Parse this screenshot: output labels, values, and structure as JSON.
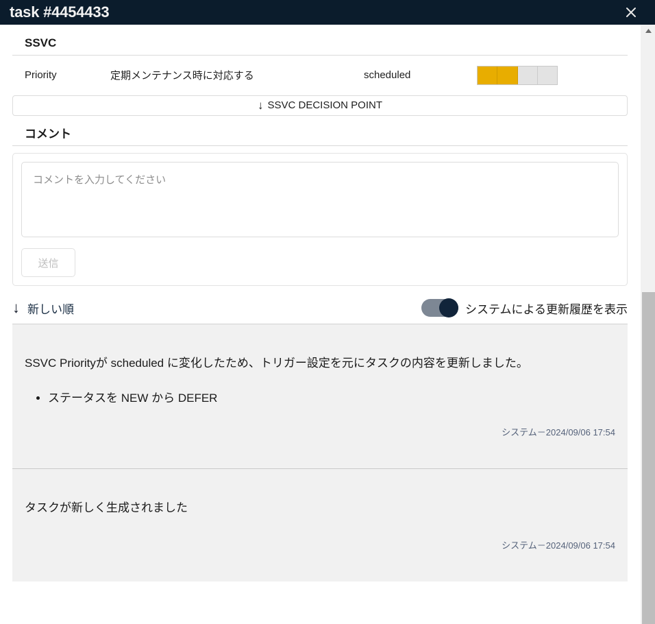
{
  "window": {
    "title": "task #4454433",
    "close_icon": "close-icon"
  },
  "ssvc": {
    "section_title": "SSVC",
    "priority_label": "Priority",
    "priority_description": "定期メンテナンス時に対応する",
    "priority_value": "scheduled",
    "meter": {
      "total_segments": 4,
      "filled_segments": 2,
      "filled_color": "#e8ad00",
      "empty_color": "#e3e3e3"
    },
    "decision_point_button": {
      "arrow": "↓",
      "label": "SSVC DECISION POINT"
    }
  },
  "comments": {
    "section_title": "コメント",
    "input_placeholder": "コメントを入力してください",
    "input_value": "",
    "submit_label": "送信",
    "submit_disabled": true
  },
  "list_controls": {
    "sort": {
      "arrow": "↓",
      "label": "新しい順"
    },
    "toggle": {
      "label": "システムによる更新履歴を表示",
      "state": "on",
      "knob_color": "#11243a",
      "track_color": "#7d8794"
    }
  },
  "history": [
    {
      "text": "SSVC Priorityが scheduled に変化したため、トリガー設定を元にタスクの内容を更新しました。",
      "bullets": [
        "ステータスを NEW から DEFER"
      ],
      "meta": "システム－2024/09/06 17:54"
    },
    {
      "text": "タスクが新しく生成されました",
      "bullets": [],
      "meta": "システム－2024/09/06 17:54"
    }
  ],
  "scrollbar": {
    "up_arrow_icon": "triangle-up-icon",
    "thumb_name": "scrollbar-thumb"
  }
}
